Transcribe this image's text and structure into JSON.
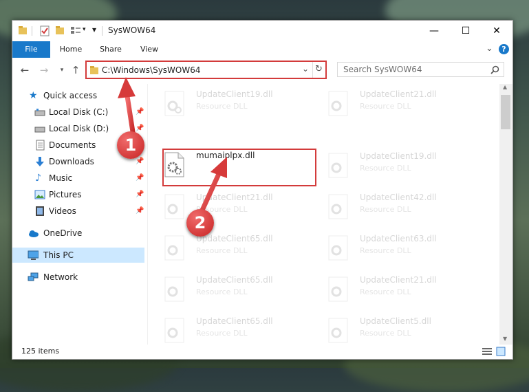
{
  "window": {
    "title": "SysWOW64",
    "minimize_glyph": "—",
    "maximize_glyph": "☐",
    "close_glyph": "✕"
  },
  "ribbon": {
    "tabs": [
      "File",
      "Home",
      "Share",
      "View"
    ],
    "collapse_glyph": "⌄",
    "help_glyph": "?"
  },
  "address": {
    "path": "C:\\Windows\\SysWOW64",
    "search_placeholder": "Search SysWOW64"
  },
  "nav": {
    "items": [
      {
        "label": "Quick access",
        "icon": "star-icon",
        "pinned": false
      },
      {
        "label": "Local Disk (C:)",
        "icon": "drive-icon",
        "pinned": true
      },
      {
        "label": "Local Disk (D:)",
        "icon": "drive-icon",
        "pinned": true
      },
      {
        "label": "Documents",
        "icon": "documents-icon",
        "pinned": true
      },
      {
        "label": "Downloads",
        "icon": "downloads-icon",
        "pinned": true
      },
      {
        "label": "Music",
        "icon": "music-icon",
        "pinned": true
      },
      {
        "label": "Pictures",
        "icon": "pictures-icon",
        "pinned": true
      },
      {
        "label": "Videos",
        "icon": "videos-icon",
        "pinned": true
      },
      {
        "label": "OneDrive",
        "icon": "cloud-icon",
        "pinned": false
      },
      {
        "label": "This PC",
        "icon": "computer-icon",
        "pinned": false,
        "selected": true
      },
      {
        "label": "Network",
        "icon": "network-icon",
        "pinned": false
      }
    ]
  },
  "files": {
    "left": [
      {
        "name": "UpdateClient19.dll",
        "type": "Resource DLL",
        "faded": true
      },
      {
        "name": "mumaiplpx.dll",
        "type": "",
        "faded": false,
        "highlighted": true
      },
      {
        "name": "UpdateClient21.dll",
        "type": "Resource DLL",
        "faded": true
      },
      {
        "name": "UpdateClient65.dll",
        "type": "Resource DLL",
        "faded": true
      },
      {
        "name": "UpdateClient65.dll",
        "type": "Resource DLL",
        "faded": true
      },
      {
        "name": "UpdateClient65.dll",
        "type": "Resource DLL",
        "faded": true
      }
    ],
    "right": [
      {
        "name": "UpdateClient21.dll",
        "type": "Resource DLL",
        "faded": true
      },
      {
        "name": "UpdateClient19.dll",
        "type": "Resource DLL",
        "faded": true
      },
      {
        "name": "UpdateClient42.dll",
        "type": "Resource DLL",
        "faded": true
      },
      {
        "name": "UpdateClient63.dll",
        "type": "Resource DLL",
        "faded": true
      },
      {
        "name": "UpdateClient21.dll",
        "type": "Resource DLL",
        "faded": true
      },
      {
        "name": "UpdateClient5.dll",
        "type": "Resource DLL",
        "faded": true
      }
    ]
  },
  "status": {
    "item_count": "125 items"
  },
  "callouts": [
    "1",
    "2"
  ],
  "colors": {
    "accent": "#1979ca",
    "highlight_red": "#d33b3b",
    "selection": "#cce8ff"
  }
}
